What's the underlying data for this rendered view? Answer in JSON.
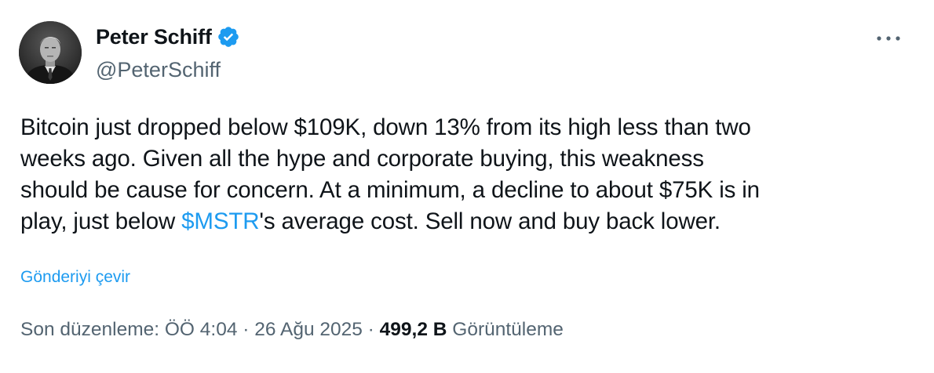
{
  "author": {
    "display_name": "Peter Schiff",
    "handle": "@PeterSchiff",
    "verified_icon": "verified-badge-icon",
    "avatar_icon": "avatar-photo"
  },
  "tweet": {
    "lines": [
      "Bitcoin just dropped below $109K, down 13% from its high less than two",
      "weeks ago. Given all the hype and corporate buying, this weakness",
      "should be cause for concern. At a minimum, a decline to about $75K is in"
    ],
    "last_line_prefix": "play, just below ",
    "cashtag": "$MSTR",
    "last_line_suffix": "'s average cost. Sell now and buy back lower."
  },
  "translate_label": "Gönderiyi çevir",
  "meta": {
    "edited_prefix": "Son düzenleme: ",
    "time": "ÖÖ 4:04",
    "separator": " · ",
    "date": "26 Ağu 2025",
    "views_count": "499,2 B",
    "views_label": " Görüntüleme"
  },
  "colors": {
    "accent": "#1d9bf0",
    "text_primary": "#0f1419",
    "text_secondary": "#536471"
  },
  "icons": {
    "more": "more-options-icon"
  }
}
